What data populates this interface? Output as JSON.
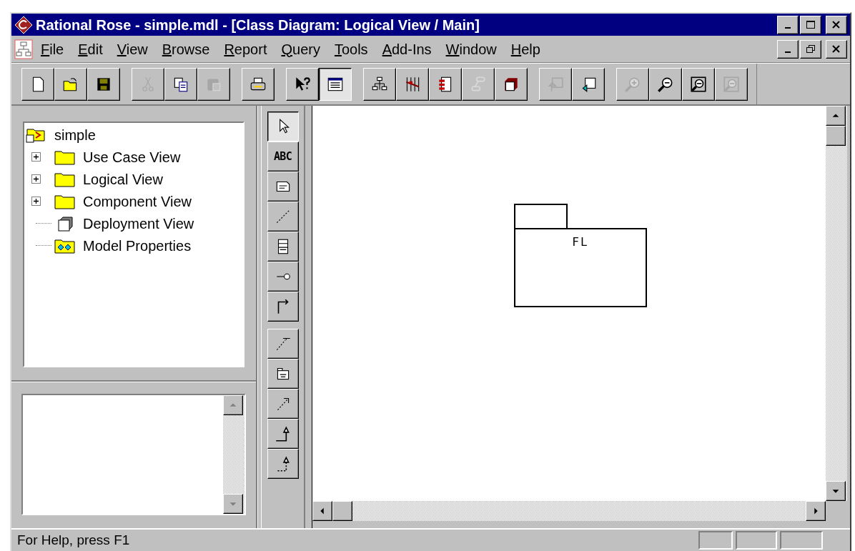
{
  "window": {
    "title": "Rational Rose - simple.mdl - [Class Diagram: Logical View / Main]"
  },
  "menu": [
    "File",
    "Edit",
    "View",
    "Browse",
    "Report",
    "Query",
    "Tools",
    "Add-Ins",
    "Window",
    "Help"
  ],
  "toolbar": [
    [
      {
        "kind": "new",
        "disabled": false,
        "pressed": false
      },
      {
        "kind": "open",
        "disabled": false,
        "pressed": false
      },
      {
        "kind": "save",
        "disabled": false,
        "pressed": false
      }
    ],
    [
      {
        "kind": "cut",
        "disabled": true,
        "pressed": false
      },
      {
        "kind": "copy",
        "disabled": false,
        "pressed": false
      },
      {
        "kind": "paste",
        "disabled": true,
        "pressed": false
      }
    ],
    [
      {
        "kind": "print",
        "disabled": false,
        "pressed": false
      }
    ],
    [
      {
        "kind": "help",
        "disabled": false,
        "pressed": false
      },
      {
        "kind": "docs",
        "disabled": false,
        "pressed": true
      }
    ],
    [
      {
        "kind": "hierarchy",
        "disabled": false,
        "pressed": false
      },
      {
        "kind": "bars",
        "disabled": false,
        "pressed": false
      },
      {
        "kind": "component",
        "disabled": false,
        "pressed": false
      },
      {
        "kind": "state",
        "disabled": true,
        "pressed": false
      },
      {
        "kind": "cube",
        "disabled": false,
        "pressed": false
      }
    ],
    [
      {
        "kind": "parent",
        "disabled": true,
        "pressed": false
      },
      {
        "kind": "previous",
        "disabled": false,
        "pressed": false
      }
    ],
    [
      {
        "kind": "zoom-in",
        "disabled": true,
        "pressed": false
      },
      {
        "kind": "zoom-out",
        "disabled": false,
        "pressed": false
      },
      {
        "kind": "fit",
        "disabled": false,
        "pressed": false
      },
      {
        "kind": "undo-fit",
        "disabled": true,
        "pressed": false
      }
    ]
  ],
  "browser": {
    "root": "simple",
    "children": [
      {
        "label": "Use Case View",
        "kind": "folder",
        "expanded": false
      },
      {
        "label": "Logical View",
        "kind": "folder",
        "expanded": false
      },
      {
        "label": "Component View",
        "kind": "folder",
        "expanded": false
      },
      {
        "label": "Deployment View",
        "kind": "node"
      },
      {
        "label": "Model Properties",
        "kind": "properties"
      }
    ]
  },
  "palette": [
    [
      {
        "kind": "select",
        "pressed": true
      },
      {
        "kind": "text",
        "label": "ABC",
        "pressed": false
      },
      {
        "kind": "note",
        "pressed": false
      },
      {
        "kind": "anchor",
        "pressed": false
      },
      {
        "kind": "class",
        "pressed": false
      },
      {
        "kind": "interface",
        "pressed": false
      },
      {
        "kind": "association",
        "pressed": false
      }
    ],
    [
      {
        "kind": "bar-dependency",
        "pressed": false
      },
      {
        "kind": "package",
        "pressed": false
      },
      {
        "kind": "dependency",
        "pressed": false
      },
      {
        "kind": "generalization",
        "pressed": false
      },
      {
        "kind": "realization",
        "pressed": false
      }
    ]
  ],
  "diagram": {
    "packages": [
      {
        "name": "FL"
      }
    ]
  },
  "status_bar": {
    "text": "For Help, press F1"
  }
}
